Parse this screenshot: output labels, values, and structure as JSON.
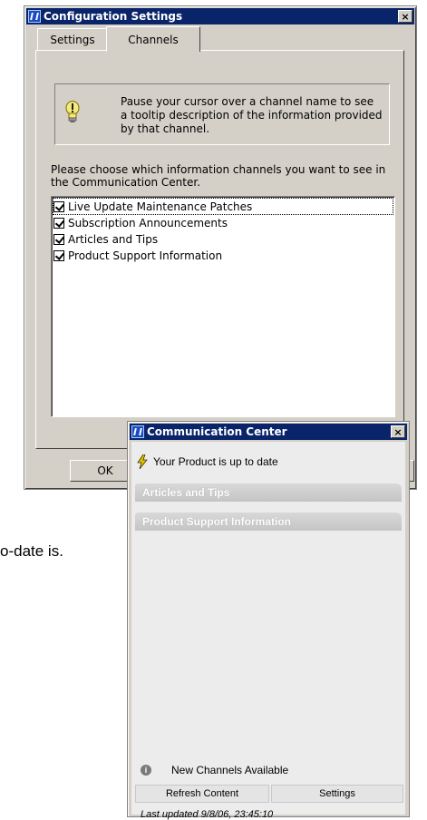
{
  "background": {
    "partial_text": "o-date is."
  },
  "config_window": {
    "title": "Configuration Settings",
    "close_glyph": "×",
    "tabs": [
      {
        "label": "Settings",
        "active": false
      },
      {
        "label": "Channels",
        "active": true
      }
    ],
    "info_text": "Pause your cursor over a channel name to see a tooltip description of the information provided by that channel.",
    "instruction": "Please choose which information channels you want to see in the Communication Center.",
    "channels": [
      {
        "label": "Live Update Maintenance Patches",
        "checked": true
      },
      {
        "label": "Subscription Announcements",
        "checked": true
      },
      {
        "label": "Articles and Tips",
        "checked": true
      },
      {
        "label": "Product Support Information",
        "checked": true
      }
    ],
    "ok_label": "OK"
  },
  "comm_center": {
    "title": "Communication Center",
    "close_glyph": "×",
    "status": "Your Product is up to date",
    "sections": [
      "Articles and Tips",
      "Product Support Information"
    ],
    "notice": "New Channels Available",
    "refresh_label": "Refresh Content",
    "settings_label": "Settings",
    "last_updated": "Last updated 9/8/06, 23:45:10"
  },
  "colors": {
    "titlebar": "#0a246a",
    "dialog_face": "#d4d0c8",
    "section_header": "#c4c4c4",
    "bolt": "#e2c400"
  },
  "icons": {
    "app": "autocad-app-icon",
    "info_tip": "lightbulb-icon",
    "status": "lightning-bolt-icon",
    "notice": "info-icon"
  }
}
